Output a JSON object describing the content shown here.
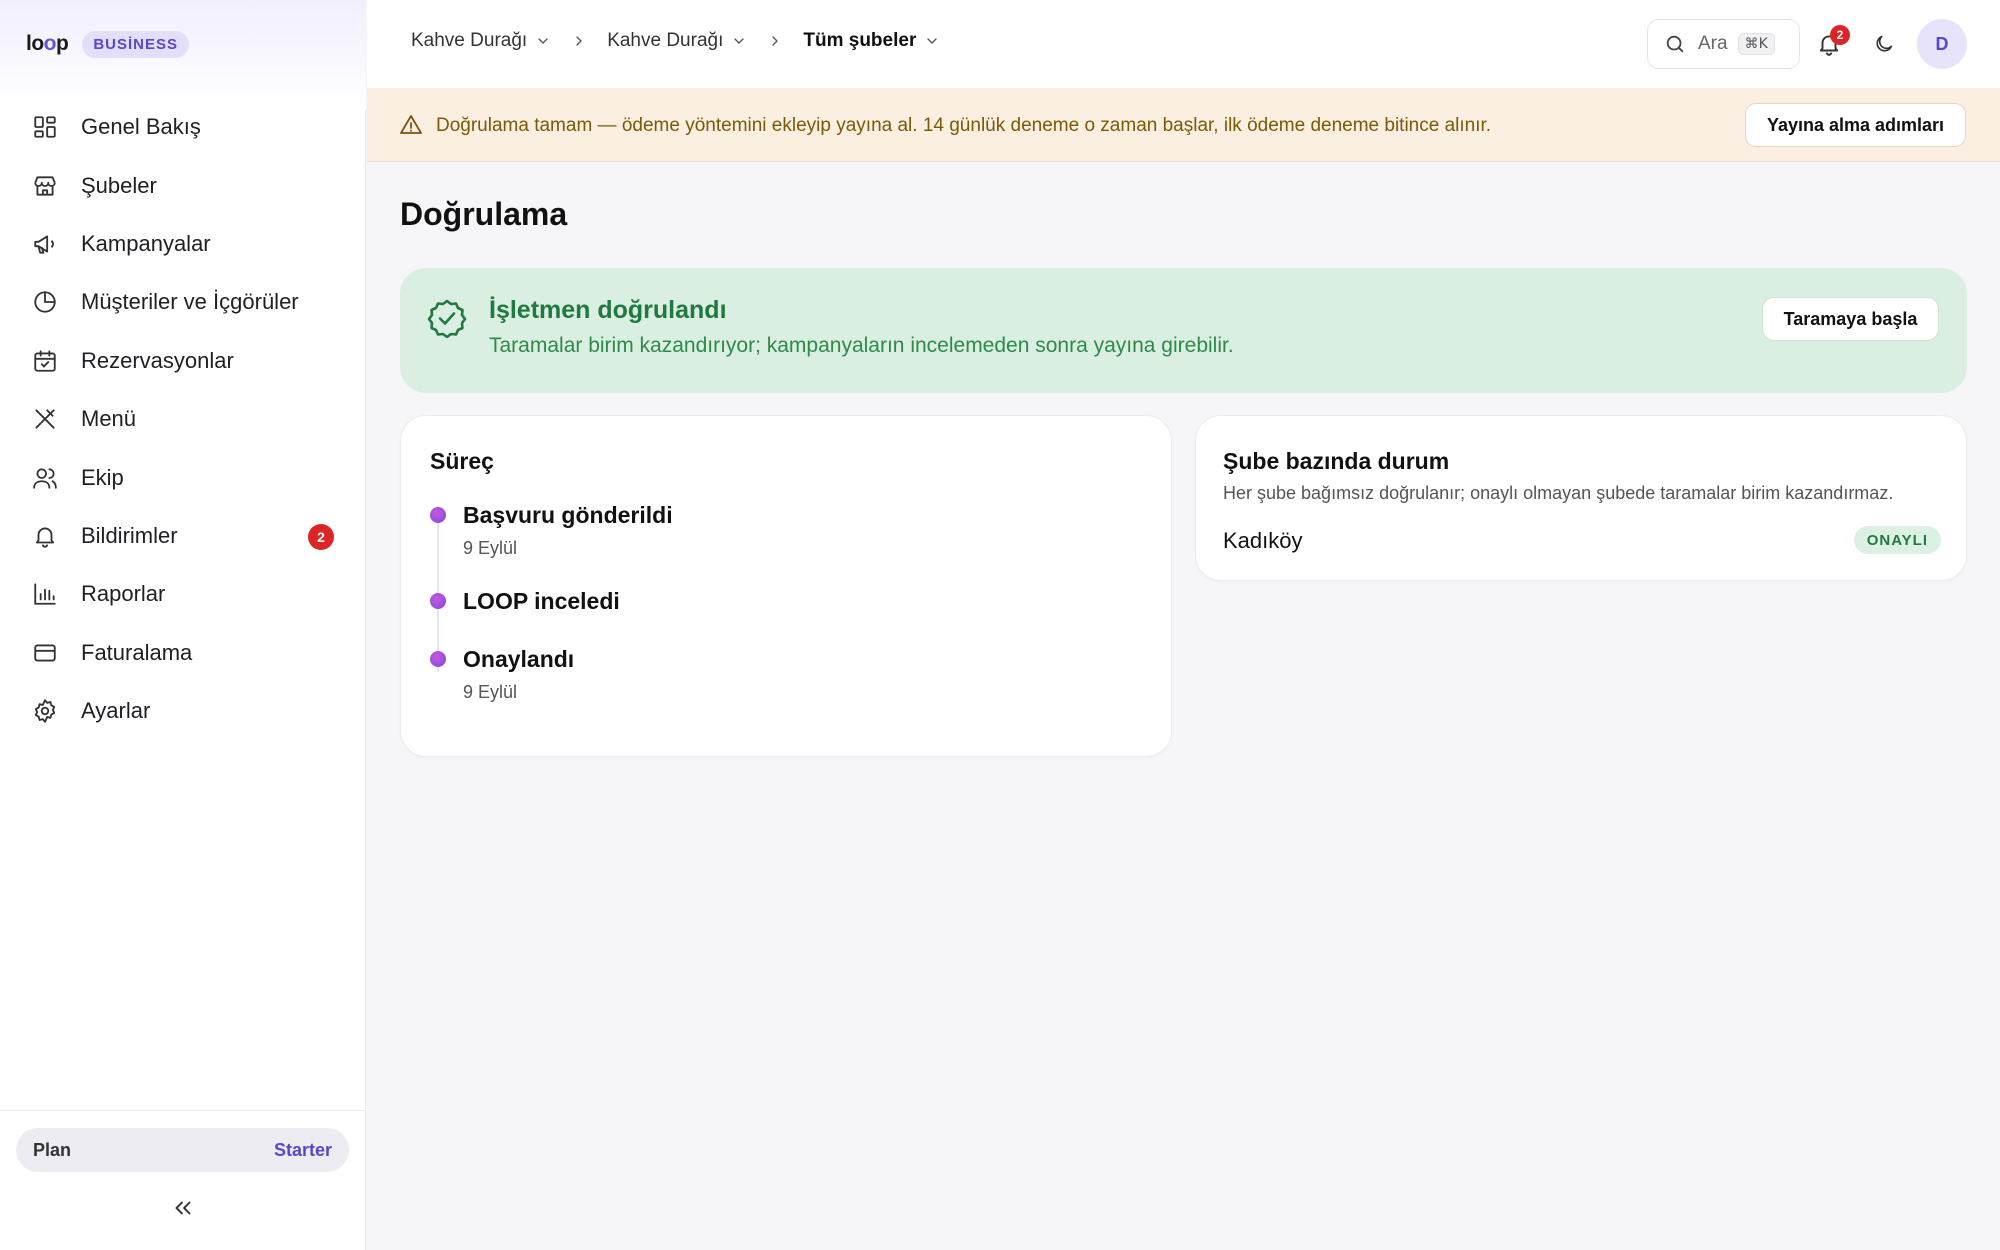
{
  "sidebar": {
    "brand": {
      "logo_l": "l",
      "logo_o1": "o",
      "logo_o2": "o",
      "logo_p": "p",
      "badge": "BUSİNESS"
    },
    "items": [
      {
        "label": "Genel Bakış",
        "icon": "dashboard-grid-icon"
      },
      {
        "label": "Şubeler",
        "icon": "store-icon"
      },
      {
        "label": "Kampanyalar",
        "icon": "megaphone-icon"
      },
      {
        "label": "Müşteriler ve İçgörüler",
        "icon": "pie-chart-icon"
      },
      {
        "label": "Rezervasyonlar",
        "icon": "calendar-check-icon"
      },
      {
        "label": "Menü",
        "icon": "utensils-icon"
      },
      {
        "label": "Ekip",
        "icon": "users-icon"
      },
      {
        "label": "Bildirimler",
        "icon": "bell-icon",
        "badge": "2"
      },
      {
        "label": "Raporlar",
        "icon": "bar-chart-icon"
      },
      {
        "label": "Faturalama",
        "icon": "credit-card-icon"
      },
      {
        "label": "Ayarlar",
        "icon": "gear-icon"
      }
    ],
    "plan": {
      "label": "Plan",
      "value": "Starter"
    }
  },
  "topbar": {
    "breadcrumbs": [
      "Kahve Durağı",
      "Kahve Durağı",
      "Tüm şubeler"
    ],
    "search": {
      "placeholder": "Ara",
      "shortcut": "⌘K"
    },
    "notifications_count": "2",
    "avatar_initial": "D"
  },
  "banner": {
    "text": "Doğrulama tamam — ödeme yöntemini ekleyip yayına al. 14 günlük deneme o zaman başlar, ilk ödeme deneme bitince alınır.",
    "button": "Yayına alma adımları"
  },
  "main": {
    "title": "Doğrulama",
    "success": {
      "title": "İşletmen doğrulandı",
      "text": "Taramalar birim kazandırıyor; kampanyaların incelemeden sonra yayına girebilir.",
      "button": "Taramaya başla"
    },
    "process": {
      "title": "Süreç",
      "steps": [
        {
          "title": "Başvuru gönderildi",
          "date": "9 Eylül"
        },
        {
          "title": "LOOP inceledi",
          "date": ""
        },
        {
          "title": "Onaylandı",
          "date": "9 Eylül"
        }
      ]
    },
    "branches": {
      "title": "Şube bazında durum",
      "subtitle": "Her şube bağımsız doğrulanır; onaylı olmayan şubede taramalar birim kazandırmaz.",
      "rows": [
        {
          "name": "Kadıköy",
          "status": "ONAYLI"
        }
      ]
    }
  },
  "colors": {
    "accent": "#5a45cf",
    "success": "#1f7a3f",
    "warning_bg": "#fbefe2",
    "badge_red": "#dc2626"
  }
}
